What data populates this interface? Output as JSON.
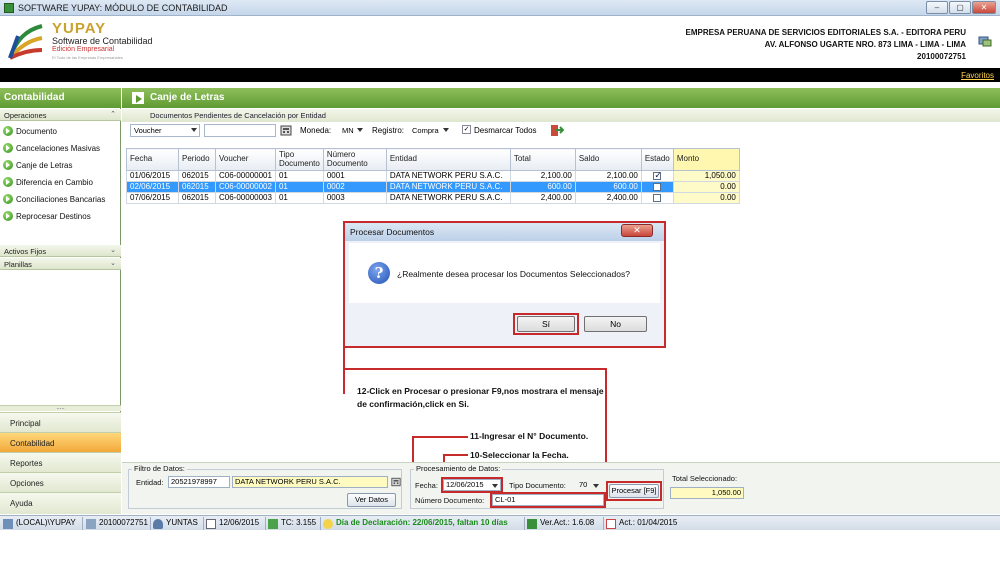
{
  "window": {
    "title": "SOFTWARE YUPAY: MÓDULO DE CONTABILIDAD",
    "minimize": "–",
    "maximize": "▢",
    "close": "✕"
  },
  "brand": {
    "name": "YUPAY",
    "product": "Software de Contabilidad",
    "edition": "Edición Empresarial",
    "tagline": "El Todo de las Empresas Empresariales"
  },
  "company": {
    "name": "EMPRESA PERUANA DE SERVICIOS EDITORIALES S.A. - EDITORA PERU",
    "address": "AV. ALFONSO UGARTE NRO. 873 LIMA - LIMA - LIMA",
    "ruc": "20100072751"
  },
  "favorites": "Favoritos",
  "sidebar": {
    "title": "Contabilidad",
    "groups": {
      "operaciones": "Operaciones",
      "activos": "Activos Fijos",
      "planillas": "Planillas"
    },
    "items": [
      {
        "label": "Documento"
      },
      {
        "label": "Cancelaciones Masivas"
      },
      {
        "label": "Canje de Letras"
      },
      {
        "label": "Diferencia en Cambio"
      },
      {
        "label": "Conciliaciones Bancarias"
      },
      {
        "label": "Reprocesar Destinos"
      }
    ],
    "nav": [
      {
        "label": "Principal"
      },
      {
        "label": "Contabilidad"
      },
      {
        "label": "Reportes"
      },
      {
        "label": "Opciones"
      },
      {
        "label": "Ayuda"
      }
    ],
    "grip": "....."
  },
  "main": {
    "title": "Canje de Letras",
    "subheader": "Documentos Pendientes de Cancelación por Entidad"
  },
  "toolbar": {
    "doc_type": "Voucher",
    "moneda_label": "Moneda:",
    "moneda_value": "MN",
    "registro_label": "Registro:",
    "registro_value": "Compra",
    "desmarcar": "Desmarcar Todos"
  },
  "table": {
    "headers": [
      "Fecha",
      "Periodo",
      "Voucher",
      "Tipo Documento",
      "Número Documento",
      "Entidad",
      "Total",
      "Saldo",
      "Estado",
      "Monto"
    ],
    "rows": [
      {
        "fecha": "01/06/2015",
        "periodo": "062015",
        "voucher": "C06-00000001",
        "tipo": "01",
        "numero": "0001",
        "entidad": "DATA NETWORK PERU S.A.C.",
        "total": "2,100.00",
        "saldo": "2,100.00",
        "estado": true,
        "monto": "1,050.00"
      },
      {
        "fecha": "02/06/2015",
        "periodo": "062015",
        "voucher": "C06-00000002",
        "tipo": "01",
        "numero": "0002",
        "entidad": "DATA NETWORK PERU S.A.C.",
        "total": "600.00",
        "saldo": "600.00",
        "estado": false,
        "monto": "0.00"
      },
      {
        "fecha": "07/06/2015",
        "periodo": "062015",
        "voucher": "C06-00000003",
        "tipo": "01",
        "numero": "0003",
        "entidad": "DATA NETWORK PERU S.A.C.",
        "total": "2,400.00",
        "saldo": "2,400.00",
        "estado": false,
        "monto": "0.00"
      }
    ]
  },
  "dialog": {
    "title": "Procesar Documentos",
    "close": "✕",
    "icon": "?",
    "message": "¿Realmente desea procesar los Documentos Seleccionados?",
    "yes": "Sí",
    "no": "No"
  },
  "annotations": {
    "a12": "12-Click en Procesar o presionar F9,nos mostrara el mensaje de confirmación,click en Si.",
    "a11": "11-Ingresar el N° Documento.",
    "a10": "10-Seleccionar la Fecha."
  },
  "filter": {
    "group_label": "Filtro de Datos:",
    "entidad_label": "Entidad:",
    "entidad_ruc": "20521978997",
    "entidad_name": "DATA NETWORK PERU S.A.C.",
    "ver_datos": "Ver Datos"
  },
  "process": {
    "group_label": "Procesamiento de Datos:",
    "fecha_label": "Fecha:",
    "fecha_value": "12/06/2015",
    "tipo_label": "Tipo Documento:",
    "tipo_value": "70",
    "numero_label": "Número Documento:",
    "numero_value": "CL-01",
    "procesar": "Procesar [F9]"
  },
  "total": {
    "label": "Total Seleccionado:",
    "value": "1,050.00"
  },
  "status": {
    "server": "(LOCAL)\\YUPAY",
    "ruc": "20100072751",
    "user": "YUNTAS",
    "date": "12/06/2015",
    "tc": "TC: 3.155",
    "declaracion": "Día de Declaración: 22/06/2015, faltan 10 días",
    "version": "Ver.Act.: 1.6.08",
    "act": "Act.: 01/04/2015"
  }
}
